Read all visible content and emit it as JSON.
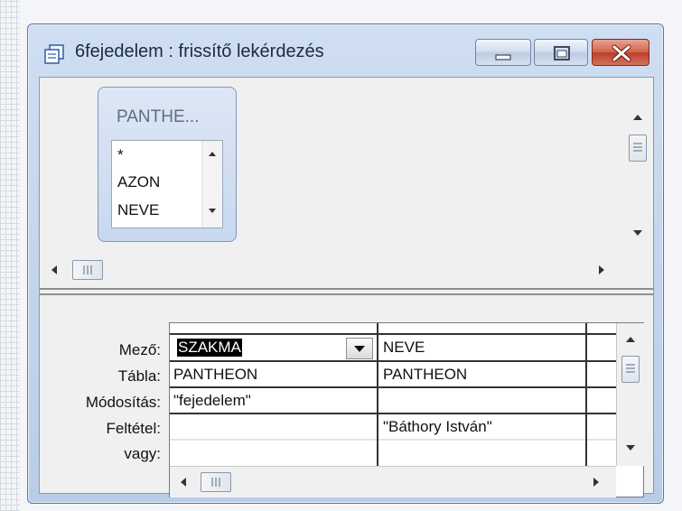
{
  "window": {
    "title": "6fejedelem : frissítő lekérdezés"
  },
  "icons": {
    "title": "query-icon",
    "minimize": "minimize-icon",
    "maximize": "maximize-icon",
    "close": "close-icon"
  },
  "table_card": {
    "title": "PANTHE...",
    "fields": [
      "*",
      "AZON",
      "NEVE"
    ]
  },
  "grid": {
    "row_labels": {
      "field": "Mező:",
      "table": "Tábla:",
      "update": "Módosítás:",
      "criteria": "Feltétel:",
      "or": "vagy:"
    },
    "columns": [
      {
        "field": "SZAKMA",
        "table": "PANTHEON",
        "update": "\"fejedelem\"",
        "criteria": ""
      },
      {
        "field": "NEVE",
        "table": "PANTHEON",
        "update": "",
        "criteria": "\"Báthory István\""
      }
    ]
  },
  "colors": {
    "titlebar": "#c4d6ee",
    "close_button": "#c84f38",
    "selection": "#000000"
  }
}
